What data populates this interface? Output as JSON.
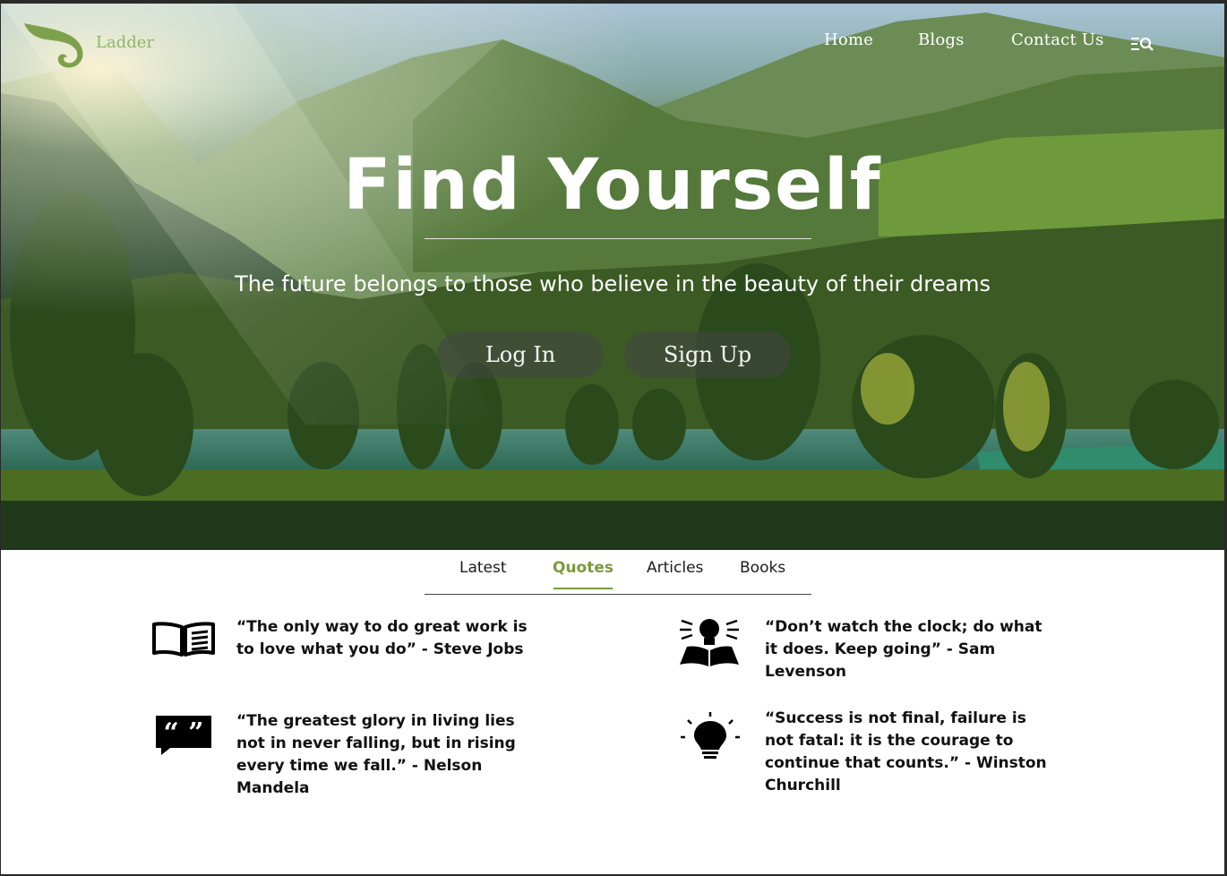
{
  "brand": {
    "name": "Ladder",
    "color": "#8fb56a"
  },
  "nav": {
    "items": [
      {
        "label": "Home"
      },
      {
        "label": "Blogs"
      },
      {
        "label": "Contact Us"
      }
    ],
    "icon": "menu-search-icon"
  },
  "hero": {
    "title": "Find Yourself",
    "subtitle": "The future belongs to those who believe in the beauty of their dreams",
    "login_label": "Log In",
    "signup_label": "Sign Up"
  },
  "tabs": {
    "items": [
      {
        "label": "Latest"
      },
      {
        "label": "Quotes"
      },
      {
        "label": "Articles"
      },
      {
        "label": "Books"
      }
    ],
    "active": "Quotes",
    "accent": "#7c9a3c"
  },
  "quotes": [
    {
      "icon": "open-book-icon",
      "text": "“The only way to do great work is to love what you do”  - Steve Jobs"
    },
    {
      "icon": "reading-idea-icon",
      "text": "“Don’t watch the clock; do what it does. Keep going”  - Sam Levenson"
    },
    {
      "icon": "quote-bubble-icon",
      "text": "“The greatest glory in living lies not in never falling, but in rising every time we fall.” - Nelson Mandela"
    },
    {
      "icon": "lightbulb-icon",
      "text": "“Success is not final, failure is not fatal: it is the courage to continue that counts.” - Winston Churchill"
    }
  ]
}
